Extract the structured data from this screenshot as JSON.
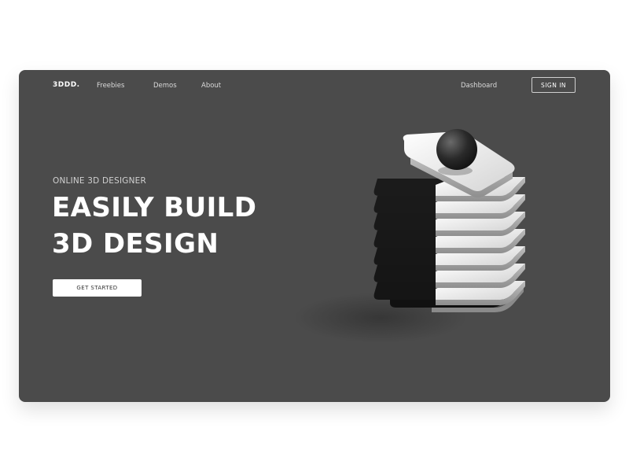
{
  "brand": {
    "logo": "3DDD."
  },
  "nav": {
    "links": [
      "Freebies",
      "Demos",
      "About"
    ],
    "dashboard": "Dashboard",
    "signin": "SIGN IN"
  },
  "hero": {
    "subtitle": "ONLINE 3D DESIGNER",
    "title_line1": "EASILY BUILD",
    "title_line2": "3D DESIGN",
    "cta": "GET STARTED"
  },
  "illustration": {
    "icon": "stacked-3d-tower-illustration"
  },
  "colors": {
    "background": "#ffffff",
    "card": "#4b4b4b",
    "text_primary": "#ffffff",
    "text_secondary": "#d0d0d0",
    "button": "#ffffff"
  }
}
